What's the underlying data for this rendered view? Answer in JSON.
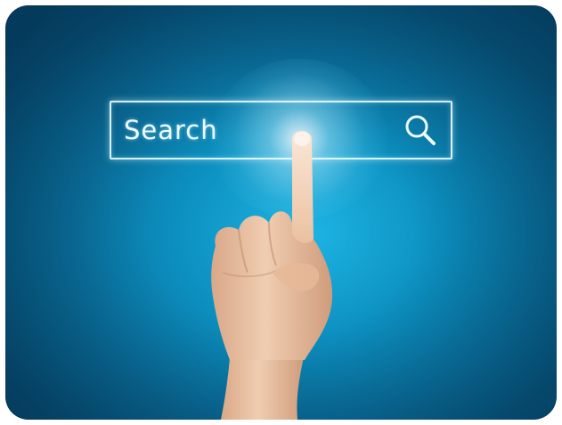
{
  "search": {
    "label": "Search",
    "icon": "search-icon"
  },
  "colors": {
    "background_center": "#1db4e3",
    "background_edge": "#06496b",
    "search_outline": "#ebfaff",
    "skin": "#e8c1a2"
  }
}
